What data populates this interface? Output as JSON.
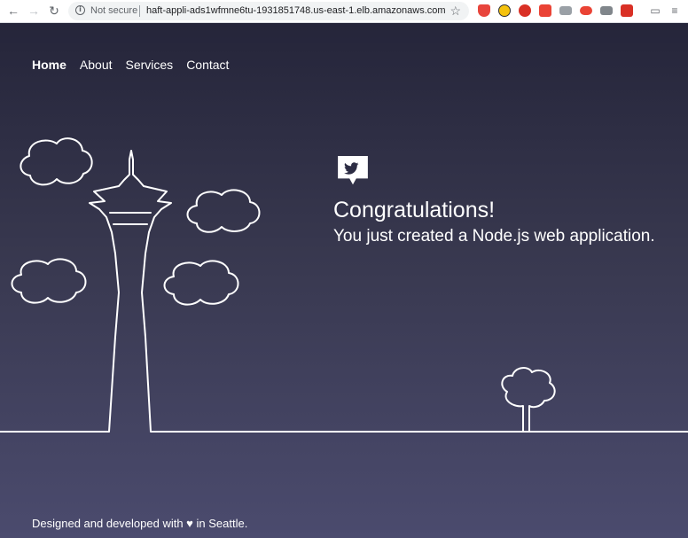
{
  "browser": {
    "security_label": "Not secure",
    "url": "haft-appli-ads1wfmne6tu-1931851748.us-east-1.elb.amazonaws.com"
  },
  "nav": {
    "items": [
      {
        "label": "Home",
        "active": true
      },
      {
        "label": "About",
        "active": false
      },
      {
        "label": "Services",
        "active": false
      },
      {
        "label": "Contact",
        "active": false
      }
    ]
  },
  "hero": {
    "title": "Congratulations!",
    "subtitle": "You just created a Node.js web application."
  },
  "footer": {
    "text": "Designed and developed with ♥ in Seattle."
  },
  "colors": {
    "bg_top": "#25253a",
    "bg_bottom": "#4b4b6e",
    "line": "#ffffff"
  }
}
